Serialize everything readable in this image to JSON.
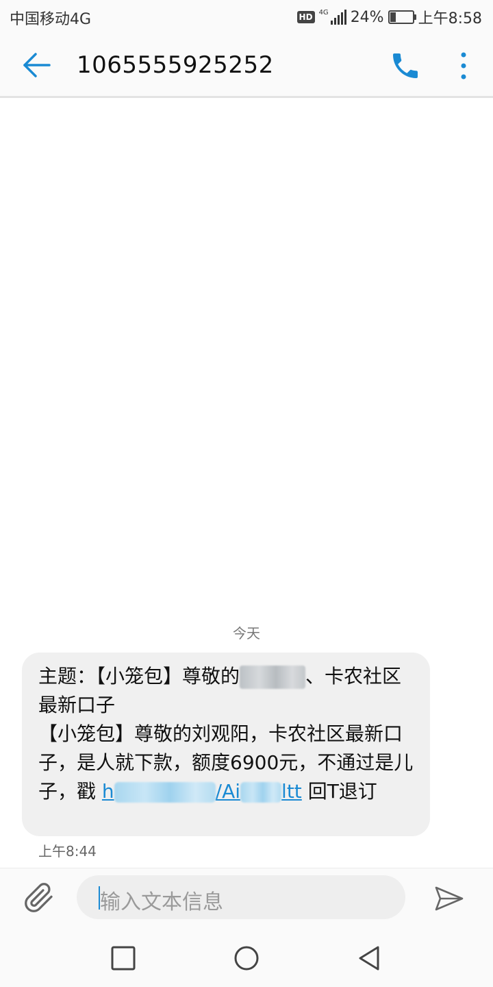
{
  "status_bar": {
    "carrier": "中国移动4G",
    "hd": "HD",
    "network": "4G",
    "battery_percent": "24%",
    "battery_level": 0.24,
    "time": "上午8:58"
  },
  "header": {
    "contact": "1065555925252",
    "icons": {
      "back": "arrow-left-icon",
      "call": "phone-icon",
      "menu": "more-vert-icon"
    }
  },
  "conversation": {
    "date_divider": "今天",
    "messages": [
      {
        "subject_prefix": "主题：【小笼包】尊敬的",
        "subject_suffix": "、卡农社区最新口子",
        "body": "【小笼包】尊敬的刘观阳，卡农社区最新口子，是人就下款，额度6900元，不通过是儿子，戳",
        "link_start": "h",
        "link_end": "/Ai",
        "link_tail": "ltt",
        "unsubscribe": "回T退订",
        "time": "上午8:44"
      }
    ]
  },
  "composer": {
    "placeholder": "输入文本信息"
  },
  "accent_color": "#1a8ad3"
}
